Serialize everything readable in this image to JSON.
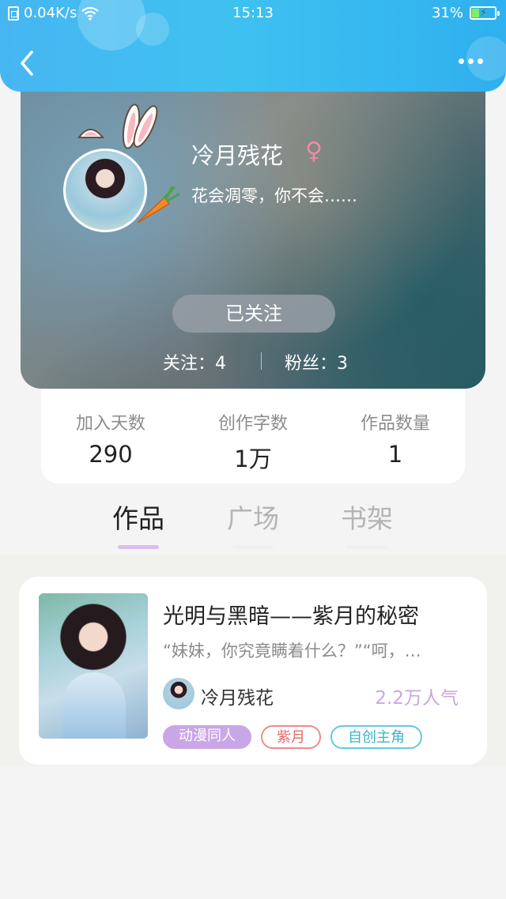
{
  "status_bar": {
    "speed": "0.04K/s",
    "time": "15:13",
    "battery": "31%"
  },
  "profile": {
    "username": "冷月残花",
    "gender_symbol": "♀",
    "signature": "花会凋零，你不会……",
    "follow_button": "已关注",
    "following_label": "关注：4",
    "fans_label": "粉丝：3"
  },
  "stats": [
    {
      "label": "加入天数",
      "value": "290"
    },
    {
      "label": "创作字数",
      "value": "1万"
    },
    {
      "label": "作品数量",
      "value": "1"
    }
  ],
  "tabs": [
    {
      "label": "作品",
      "active": true
    },
    {
      "label": "广场",
      "active": false
    },
    {
      "label": "书架",
      "active": false
    }
  ],
  "work": {
    "title": "光明与黑暗——紫月的秘密",
    "snippet": "“妹妹，你究竟瞒着什么？”“呵，…",
    "author": "冷月残花",
    "popularity": "2.2万人气",
    "tags": [
      "动漫同人",
      "紫月",
      "自创主角"
    ]
  },
  "colors": {
    "header": "#3fc1f0",
    "tab_active_underline": "#d9bdf0",
    "popularity": "#c9a6e6",
    "tag_1_bg": "#c9a6e6",
    "tag_2_border": "#f08a8a",
    "tag_3_border": "#66c9dc"
  },
  "icons": {
    "back": "chevron-left-icon",
    "more": "more-dots-icon",
    "wifi": "wifi-icon",
    "battery": "battery-icon"
  }
}
